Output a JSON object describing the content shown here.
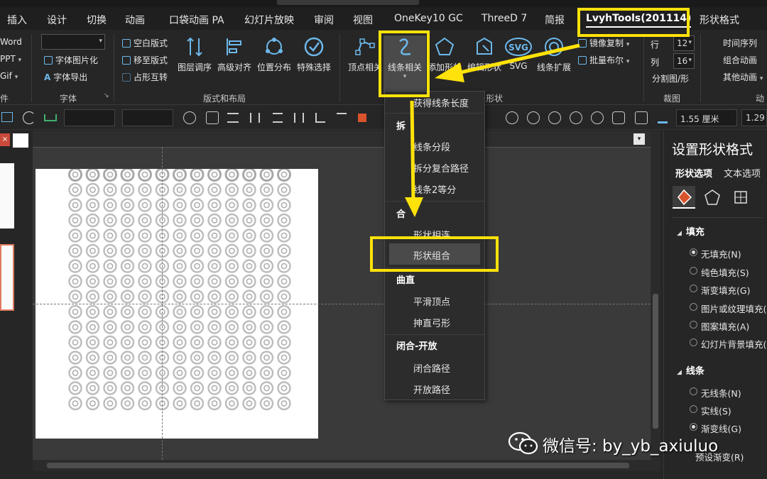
{
  "menu_tabs": [
    "插入",
    "设计",
    "切换",
    "动画",
    "口袋动画 PA",
    "幻灯片放映",
    "审阅",
    "视图",
    "OneKey10 GC",
    "ThreeD 7",
    "简报",
    "LvyhTools(201114)",
    "形状格式"
  ],
  "ribbon": {
    "left_items": [
      "Word",
      "PPT",
      "Gif"
    ],
    "font_group": {
      "items": [
        "字体图片化",
        "字体导出"
      ],
      "label": "字体",
      "label_left_fragment": "件"
    },
    "layout_group": {
      "small_items": [
        "空白版式",
        "移至版式",
        "占形互转"
      ],
      "buttons": [
        "图层调序",
        "高级对齐",
        "位置分布",
        "特殊选择"
      ],
      "label": "版式和布局"
    },
    "shape_group": {
      "buttons": [
        "顶点相关",
        "线条相关",
        "添加形状",
        "编辑形状",
        "SVG",
        "线条扩展"
      ],
      "label_fragment": "形状",
      "svg_icon_text": "SVG"
    },
    "extra_small": [
      "镜像复制",
      "批量布尔"
    ],
    "crop_group": {
      "row_label": "行",
      "col_label": "列",
      "row_value": "12",
      "col_value": "16",
      "action": "分割图/形",
      "label": "裁图"
    },
    "anim_group": {
      "items": [
        "时间序列",
        "组合动画",
        "其他动画"
      ],
      "label_fragment": "动"
    }
  },
  "toolbar2": {
    "width_value": "1.55 厘米",
    "height_value": "1.29"
  },
  "dropdown": {
    "items": [
      {
        "type": "item",
        "label": "获得线条长度"
      },
      {
        "type": "head",
        "label": "拆"
      },
      {
        "type": "item",
        "label": "线条分段"
      },
      {
        "type": "item",
        "label": "拆分复合路径"
      },
      {
        "type": "item",
        "label": "线条2等分"
      },
      {
        "type": "head",
        "label": "合"
      },
      {
        "type": "item",
        "label": "形状相连"
      },
      {
        "type": "item",
        "label": "形状组合"
      },
      {
        "type": "head",
        "label": "曲直"
      },
      {
        "type": "item",
        "label": "平滑顶点"
      },
      {
        "type": "item",
        "label": "抻直弓形"
      },
      {
        "type": "head",
        "label": "闭合-开放"
      },
      {
        "type": "item",
        "label": "闭合路径"
      },
      {
        "type": "item",
        "label": "开放路径"
      }
    ]
  },
  "format_pane": {
    "title": "设置形状格式",
    "tabs": [
      "形状选项",
      "文本选项"
    ],
    "fill_section": "填充",
    "fill_options": [
      "无填充(N)",
      "纯色填充(S)",
      "渐变填充(G)",
      "图片或纹理填充(",
      "图案填充(A)",
      "幻灯片背景填充("
    ],
    "line_section": "线条",
    "line_options": [
      "无线条(N)",
      "实线(S)",
      "渐变线(G)"
    ],
    "preset_label": "预设渐变(R)"
  },
  "watermark": "微信号: by_yb_axiuluo",
  "colors": {
    "highlight": "#ffe20a",
    "accent_blue": "#6db8ea",
    "panel_dark": "#262626"
  }
}
